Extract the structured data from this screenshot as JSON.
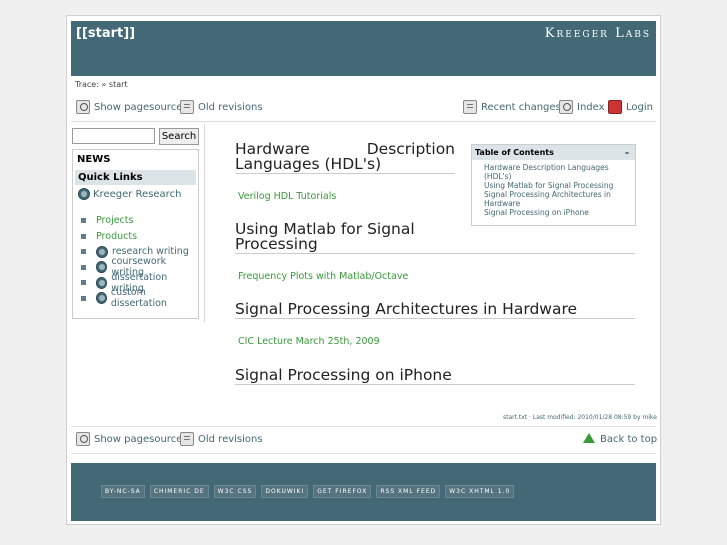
{
  "header": {
    "wiki_title": "[[start]]",
    "brand": "Kreeger Labs"
  },
  "trace": {
    "label": "Trace:",
    "sep": "»",
    "current": "start"
  },
  "topbar": {
    "show_source": "Show pagesource",
    "old_revisions": "Old revisions",
    "recent_changes": "Recent changes",
    "index": "Index",
    "login": "Login"
  },
  "sidebar": {
    "search_placeholder": "",
    "search_button": "Search",
    "news": "NEWS",
    "quick_links": "Quick Links",
    "kreeger_research": "Kreeger Research",
    "items": [
      {
        "label": "Projects",
        "icon": "none"
      },
      {
        "label": "Products",
        "icon": "none"
      },
      {
        "label": "research writing",
        "icon": "globe-icon"
      },
      {
        "label": "coursework writing",
        "icon": "globe-icon"
      },
      {
        "label": "dissertation writing",
        "icon": "globe-icon"
      },
      {
        "label": "custom dissertation",
        "icon": "globe-icon"
      }
    ]
  },
  "content": {
    "sections": [
      {
        "heading_line1_a": "Hardware",
        "heading_line1_b": "Description",
        "heading_line2": "Languages (HDL's)",
        "link": "Verilog HDL Tutorials"
      },
      {
        "heading_line1_a": "Using Matlab for Signal",
        "heading_line2": "Processing",
        "link": "Frequency Plots with Matlab/Octave"
      },
      {
        "heading": "Signal Processing Architectures in Hardware",
        "link": "CIC Lecture March 25th, 2009"
      },
      {
        "heading": "Signal Processing on iPhone"
      }
    ]
  },
  "toc": {
    "title": "Table of Contents",
    "toggle": "–",
    "items": [
      "Hardware Description Languages (HDL's)",
      "Using Matlab for Signal Processing",
      "Signal Processing Architectures in Hardware",
      "Signal Processing on iPhone"
    ]
  },
  "meta": {
    "text": "start.txt · Last modified: 2010/01/28 08:59 by mike"
  },
  "bottombar": {
    "show_source": "Show pagesource",
    "old_revisions": "Old revisions",
    "back_to_top": "Back to top"
  },
  "footer": {
    "badges": [
      "BY-NC-SA",
      "CHIMERIC DE",
      "W3C CSS",
      "DOKUWIKI",
      "GET FIREFOX",
      "RSS XML FEED",
      "W3C XHTML 1.0"
    ]
  },
  "colors": {
    "header_bg": "#436976",
    "link_green": "#3a9a3a",
    "link_blue": "#436976"
  }
}
